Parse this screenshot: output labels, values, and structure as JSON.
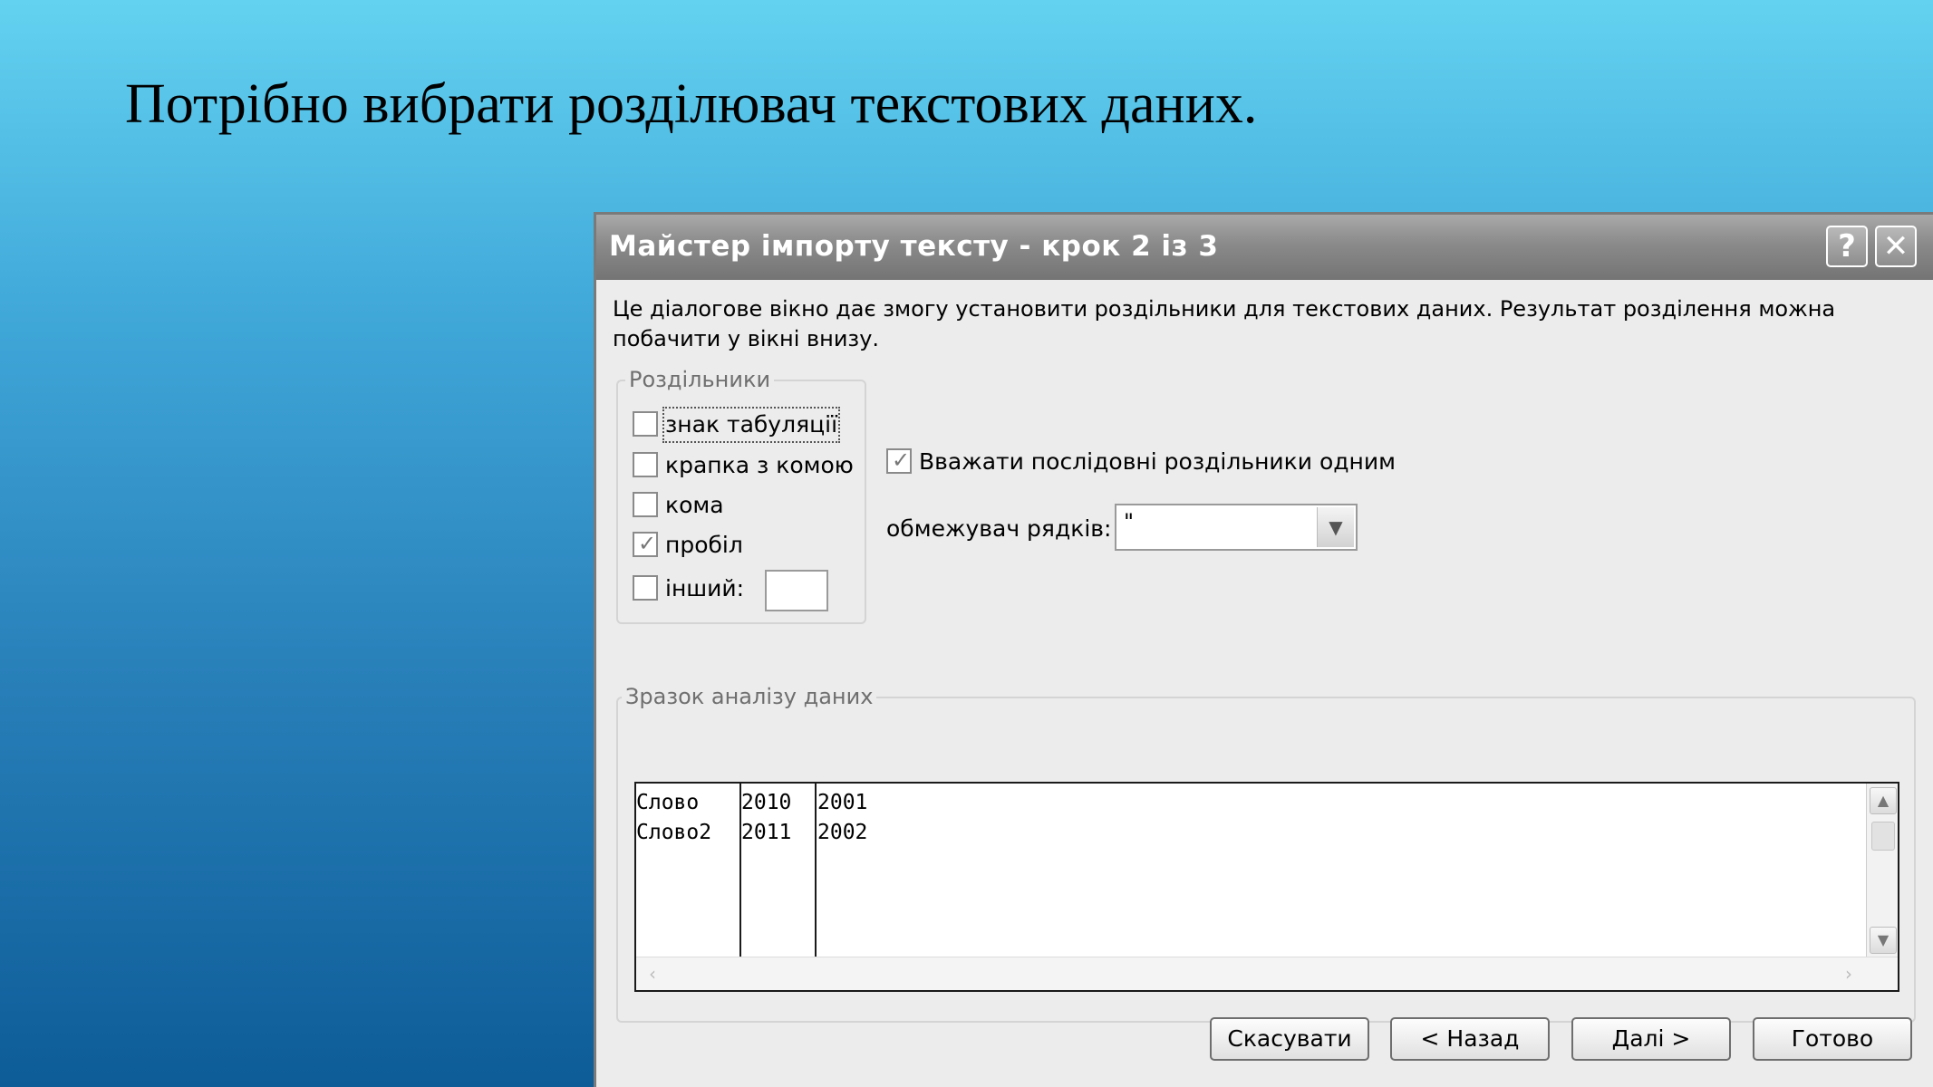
{
  "slide": {
    "title": "Потрібно вибрати розділювач текстових даних."
  },
  "dialog": {
    "title": "Майстер імпорту тексту - крок 2 із 3",
    "help_label": "?",
    "close_label": "✕",
    "description": "Це діалогове вікно дає змогу установити роздільники для текстових даних. Результат розділення можна побачити у вікні внизу.",
    "separators": {
      "legend": "Роздільники",
      "items": [
        {
          "label": "знак табуляції",
          "checked": false
        },
        {
          "label": "крапка з комою",
          "checked": false
        },
        {
          "label": "кома",
          "checked": false
        },
        {
          "label": "пробіл",
          "checked": true
        },
        {
          "label": "інший:",
          "checked": false
        }
      ]
    },
    "consecutive": {
      "label": "Вважати послідовні роздільники одним",
      "checked": true
    },
    "qualifier": {
      "label": "обмежувач рядків:",
      "value": "\""
    },
    "preview": {
      "legend": "Зразок аналізу даних",
      "rows": [
        [
          "Слово",
          "2010",
          "2001"
        ],
        [
          "Слово2",
          "2011",
          "2002"
        ]
      ]
    },
    "buttons": {
      "cancel": "Скасувати",
      "back": "< Назад",
      "next": "Далі >",
      "finish": "Готово"
    }
  }
}
